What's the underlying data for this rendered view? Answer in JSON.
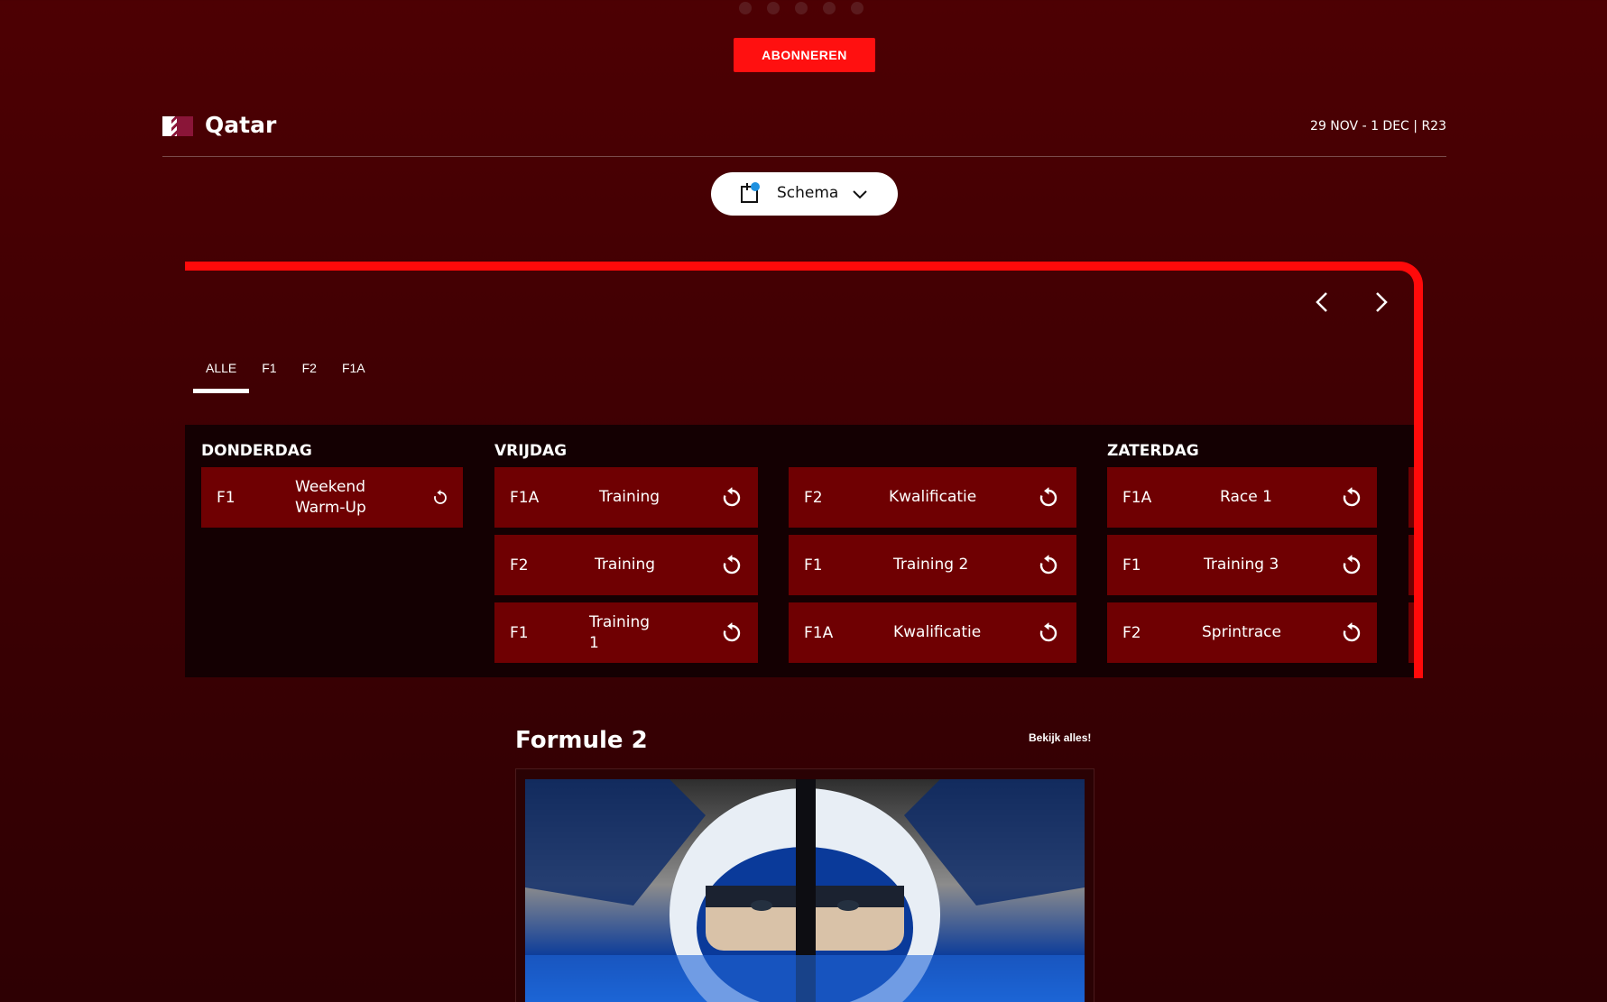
{
  "subscribe_label": "ABONNEREN",
  "event": {
    "country": "Qatar",
    "dates": "29 NOV - 1 DEC | R23"
  },
  "schema": {
    "label": "Schema"
  },
  "tabs": [
    "ALLE",
    "F1",
    "F2",
    "F1A"
  ],
  "days": [
    {
      "label": "DONDERDAG"
    },
    {
      "label": "VRIJDAG"
    },
    {
      "label": "ZATERDAG"
    }
  ],
  "sessions": [
    {
      "series": "F1",
      "name": "Weekend Warm-Up"
    },
    {
      "series": "F1A",
      "name": "Training"
    },
    {
      "series": "F2",
      "name": "Training"
    },
    {
      "series": "F1",
      "name": "Training 1"
    },
    {
      "series": "F2",
      "name": "Kwalificatie"
    },
    {
      "series": "F1",
      "name": "Training 2"
    },
    {
      "series": "F1A",
      "name": "Kwalificatie"
    },
    {
      "series": "F1A",
      "name": "Race 1"
    },
    {
      "series": "F1",
      "name": "Training 3"
    },
    {
      "series": "F2",
      "name": "Sprintrace"
    }
  ],
  "section": {
    "title": "Formule 2",
    "see_all": "Bekijk alles!"
  },
  "colors": {
    "accent": "#ff0a0a",
    "session_bg": "#6f0002",
    "bg": "#4d0003"
  }
}
